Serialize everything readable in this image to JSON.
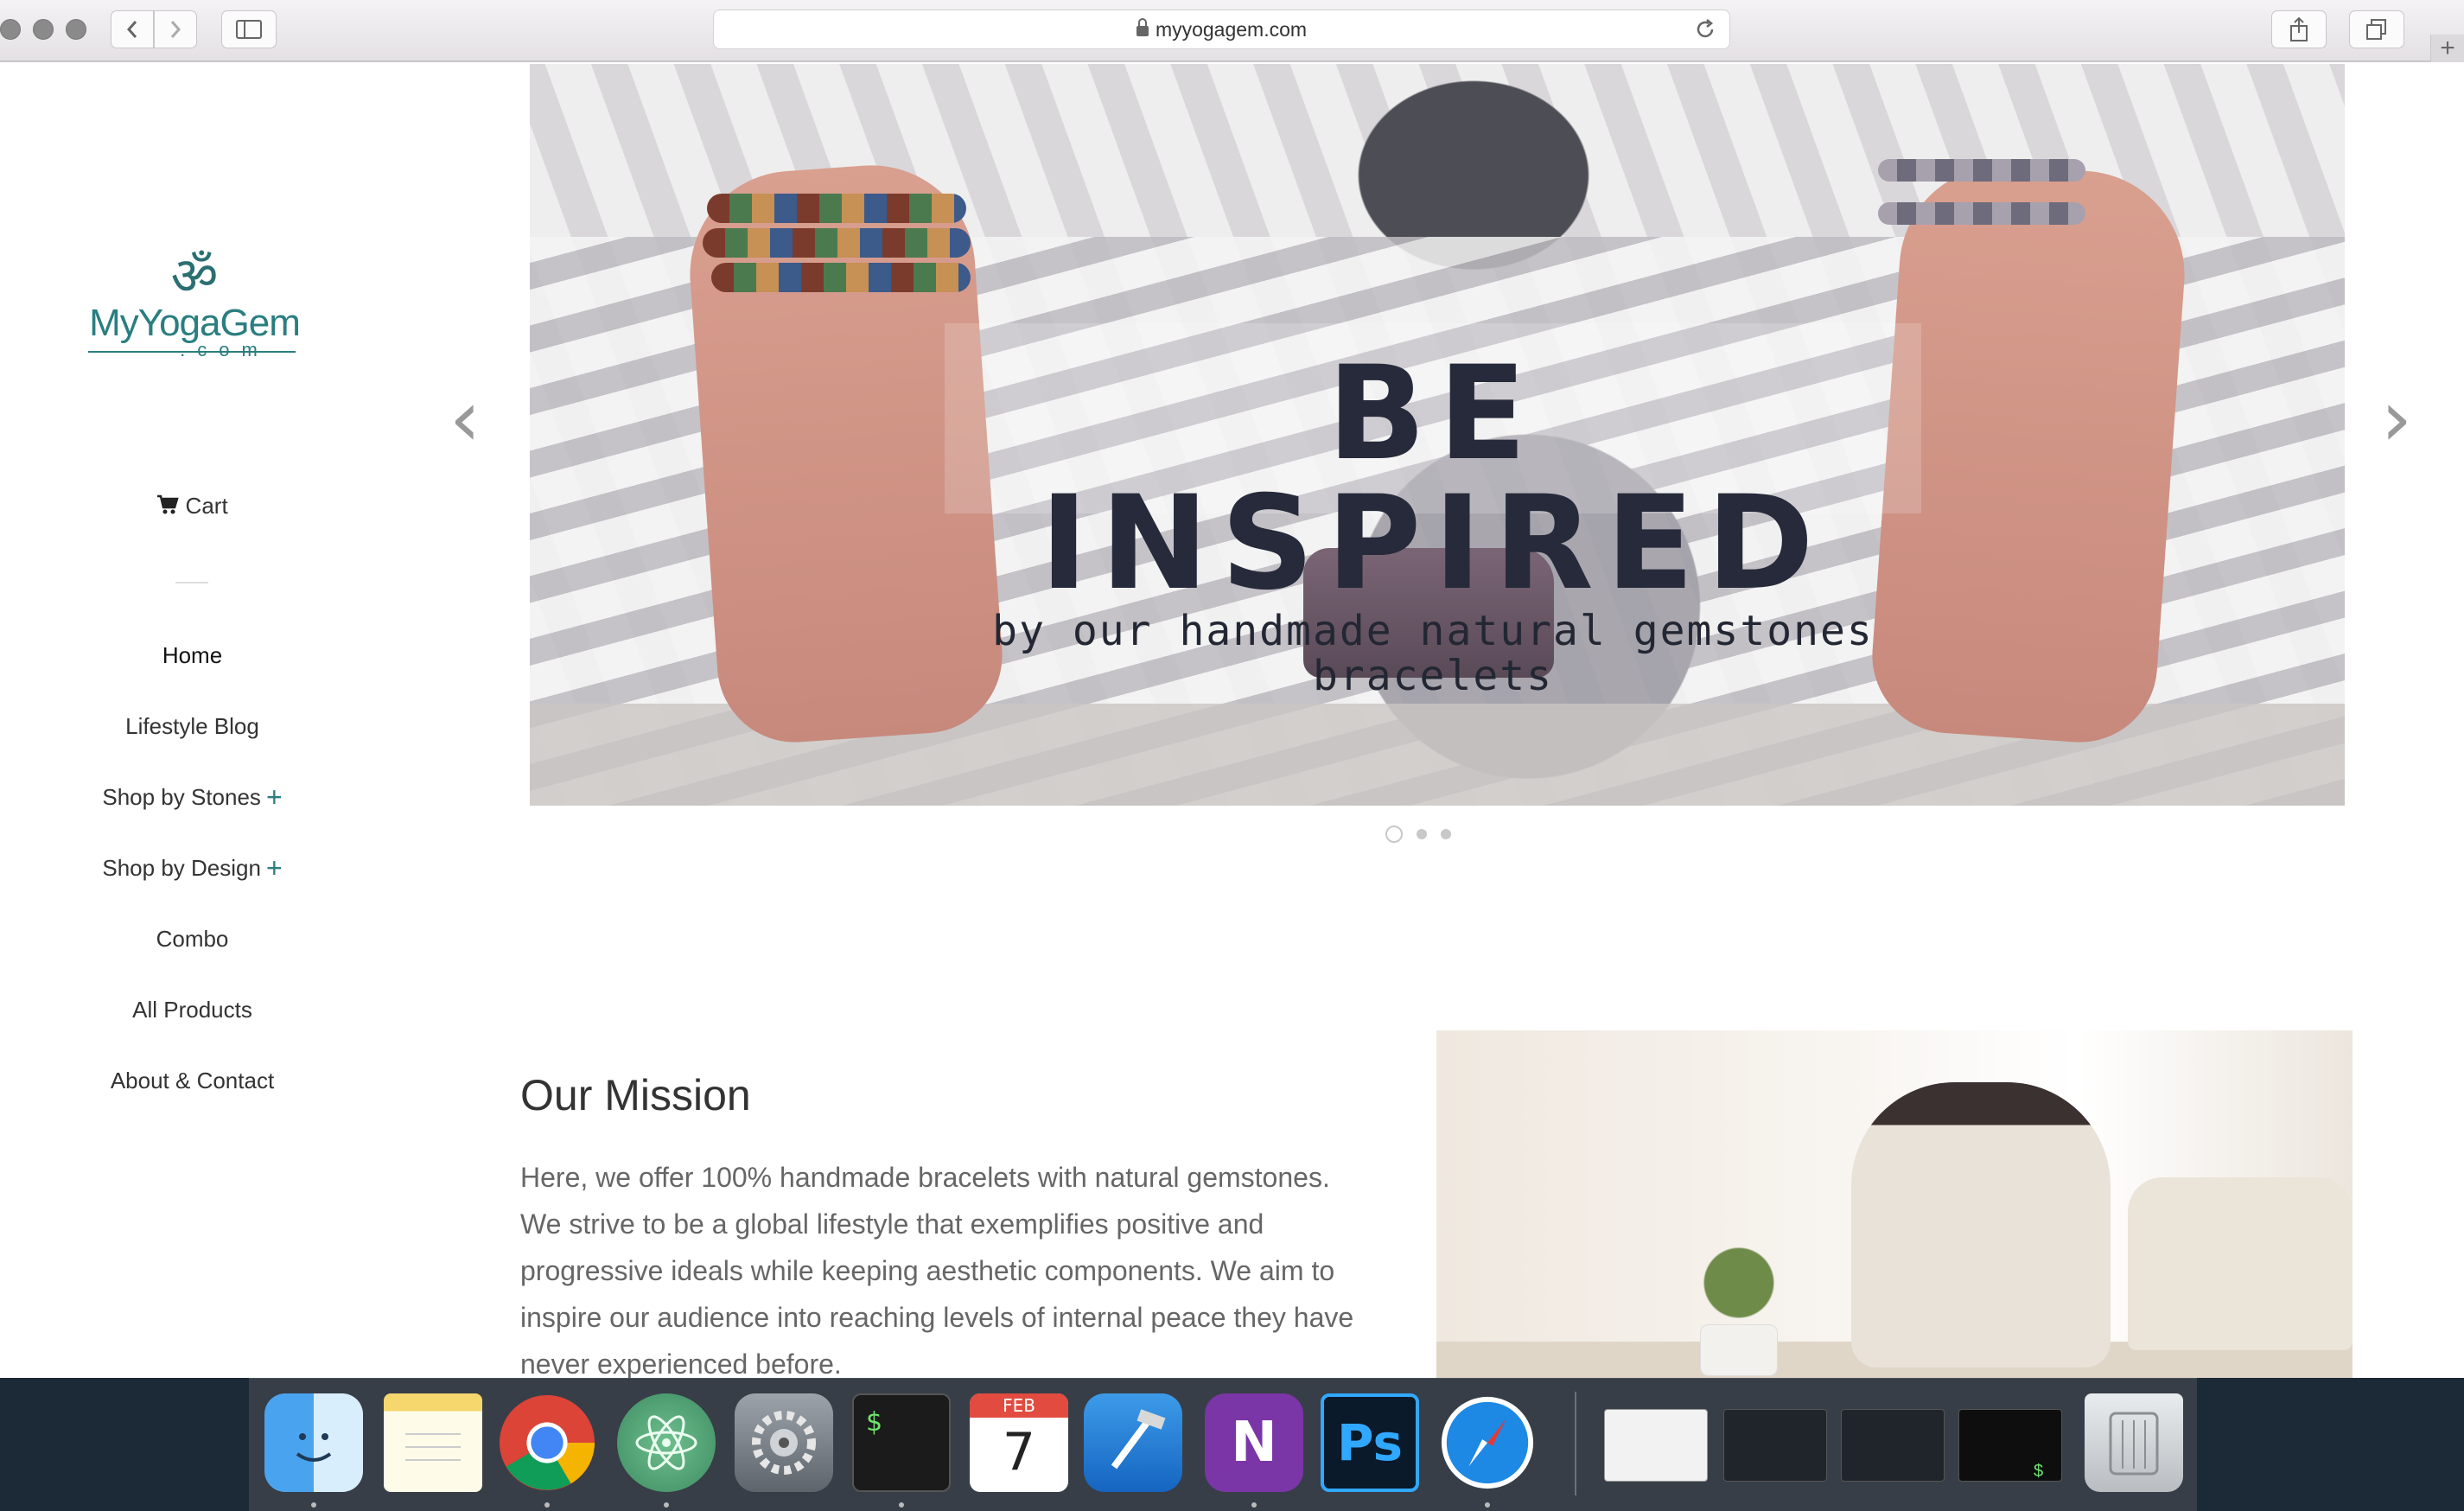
{
  "browser": {
    "url": "myyogagem.com",
    "new_tab_label": "+"
  },
  "sidebar": {
    "logo": {
      "symbol": "ॐ",
      "name": "MyYogaGem",
      "sub": ".com"
    },
    "cart_label": "Cart",
    "nav": [
      {
        "label": "Home",
        "active": true
      },
      {
        "label": "Lifestyle Blog"
      },
      {
        "label": "Shop by Stones",
        "expandable": true
      },
      {
        "label": "Shop by Design",
        "expandable": true
      },
      {
        "label": "Combo"
      },
      {
        "label": "All Products"
      },
      {
        "label": "About & Contact"
      }
    ],
    "expand_symbol": "+"
  },
  "hero": {
    "headline": "BE INSPIRED",
    "subline": "by our handmade natural gemstones bracelets",
    "prev_arrow": "‹",
    "next_arrow": "›",
    "slide_count": 3,
    "active_slide": 1
  },
  "mission": {
    "title": "Our Mission",
    "body": "Here, we offer 100% handmade bracelets with natural gemstones. We strive to be a global lifestyle that exemplifies positive and progressive ideals while keeping aesthetic components. We aim to inspire our audience into reaching levels of internal peace they have never experienced before."
  },
  "dock": {
    "apps": [
      {
        "name": "Finder",
        "icon": "finder-icon"
      },
      {
        "name": "Notes",
        "icon": "notes-icon"
      },
      {
        "name": "Chrome",
        "icon": "chrome-icon"
      },
      {
        "name": "Atom",
        "icon": "atom-icon"
      },
      {
        "name": "System Preferences",
        "icon": "gear-icon"
      },
      {
        "name": "Terminal",
        "icon": "terminal-icon",
        "glyph": "$"
      },
      {
        "name": "Calendar",
        "icon": "calendar-icon",
        "month": "FEB",
        "day": "7"
      },
      {
        "name": "Xcode",
        "icon": "xcode-icon"
      },
      {
        "name": "OneNote",
        "icon": "onenote-icon",
        "glyph": "N"
      },
      {
        "name": "Photoshop",
        "icon": "photoshop-icon",
        "glyph": "Ps"
      },
      {
        "name": "Safari",
        "icon": "safari-icon"
      },
      {
        "name": "Trash",
        "icon": "trash-icon"
      }
    ],
    "thumb_glyph": "$"
  },
  "colors": {
    "accent": "#2a7e80",
    "text": "#333333",
    "muted": "#666666",
    "headline": "#262a3a"
  }
}
